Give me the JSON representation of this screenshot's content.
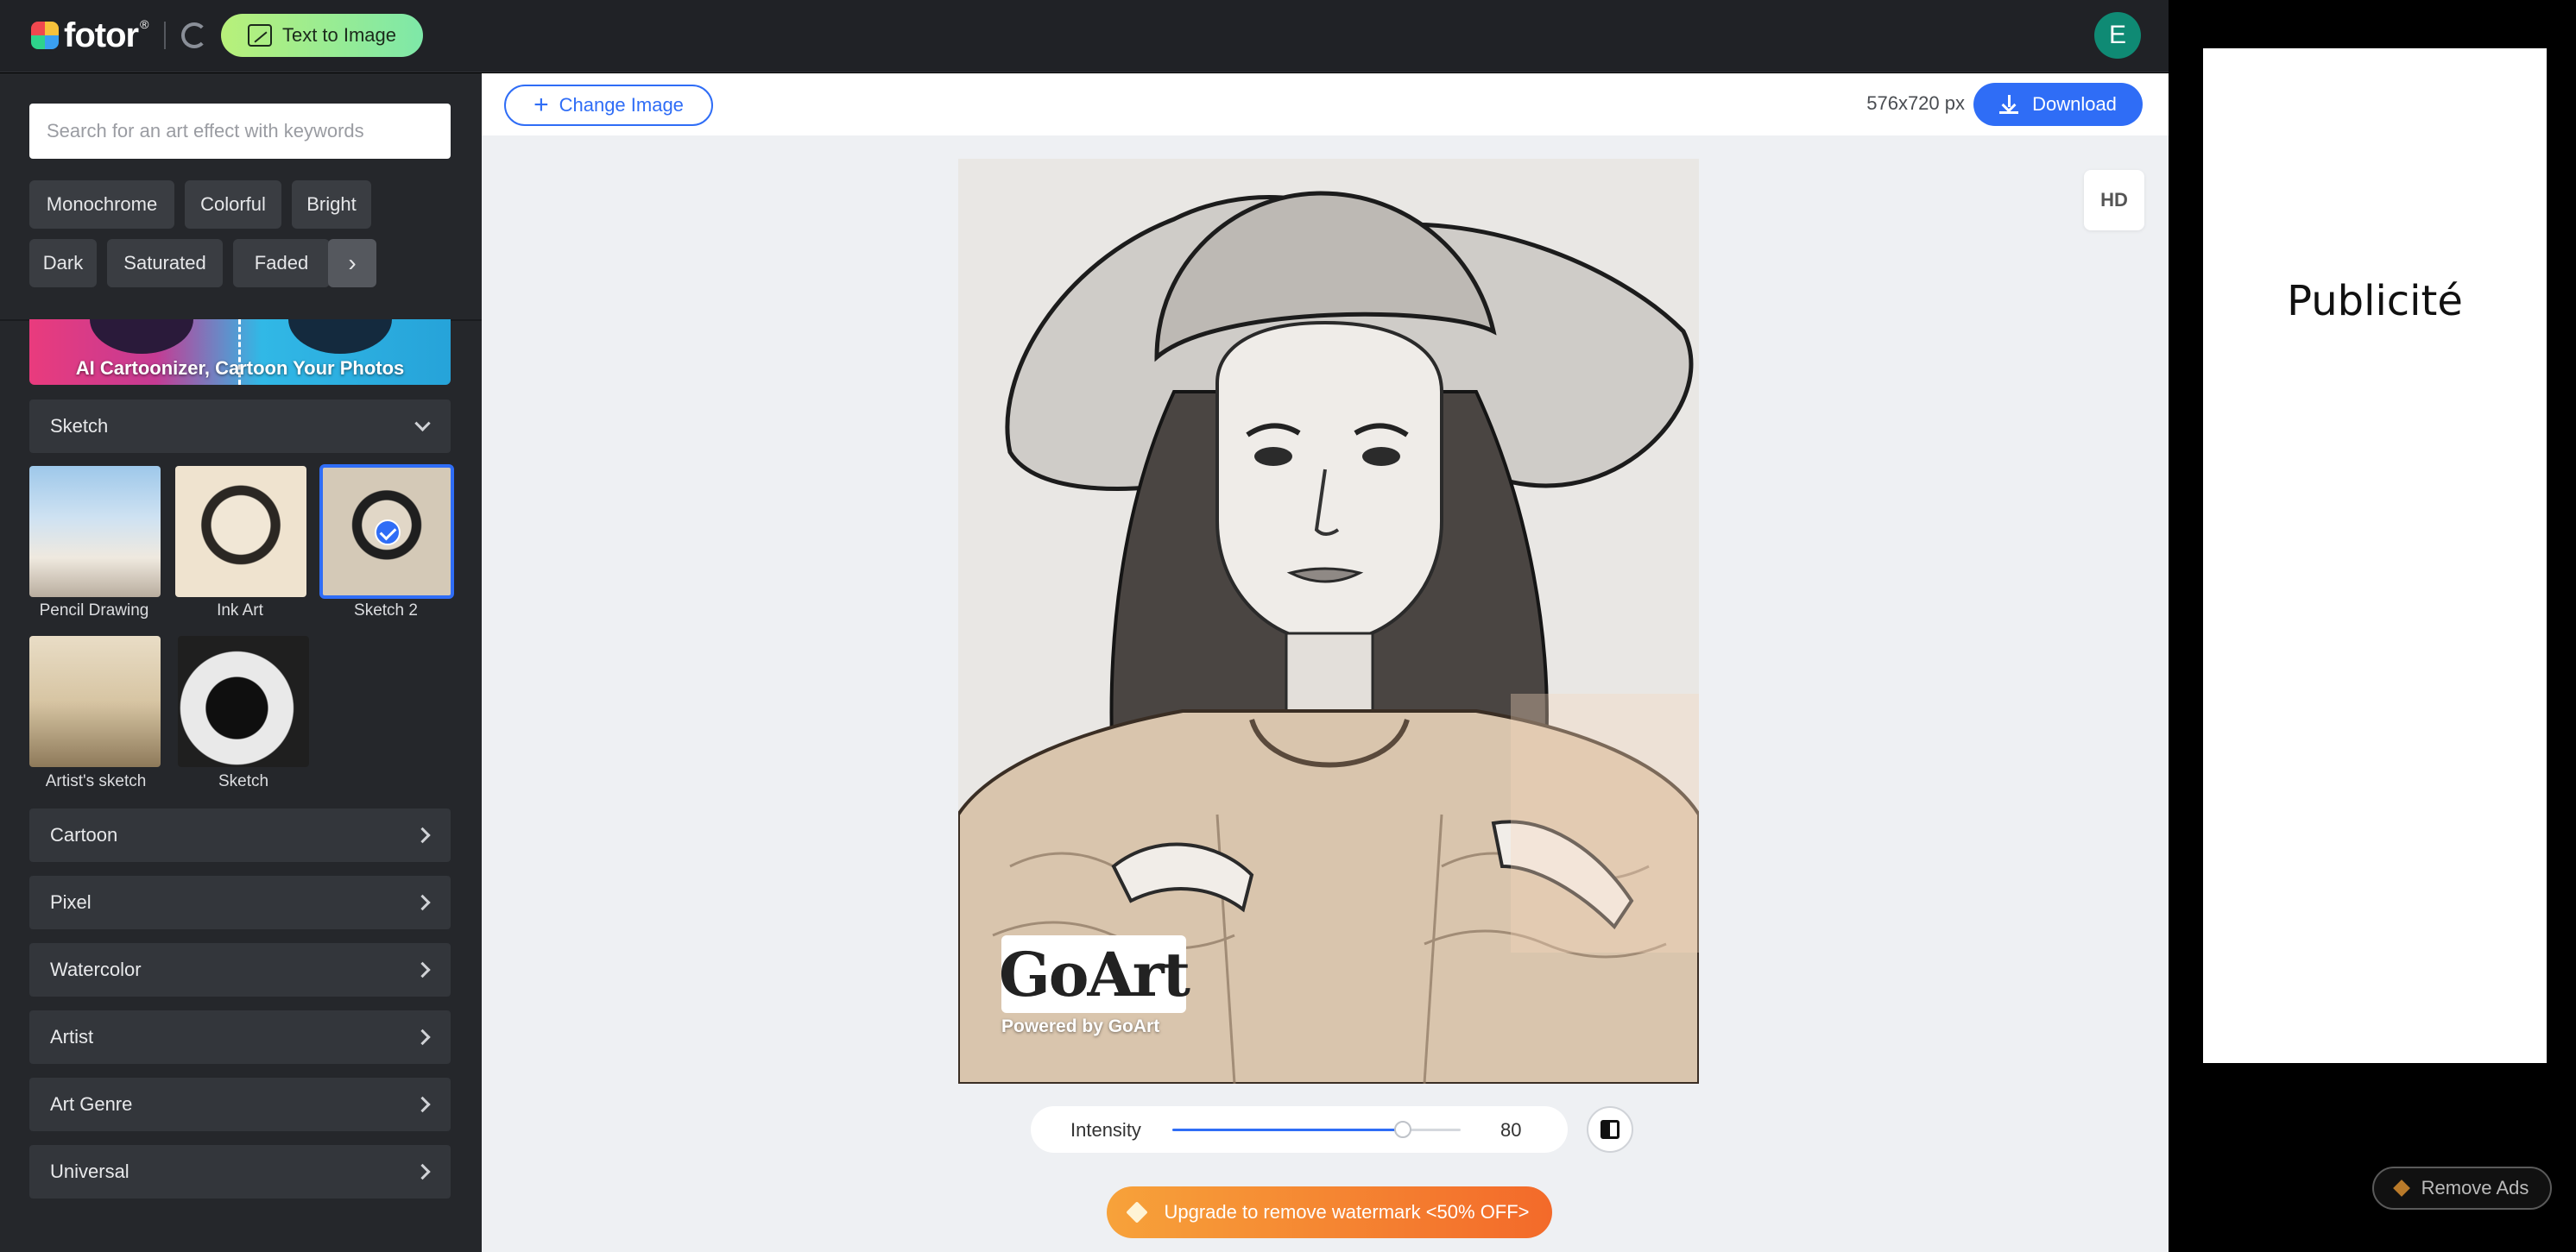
{
  "header": {
    "logo_text": "fotor",
    "logo_reg": "®",
    "text_to_image_label": "Text to Image",
    "avatar_initial": "E"
  },
  "sidebar": {
    "search_placeholder": "Search for an art effect with keywords",
    "filter_chips": [
      "Monochrome",
      "Colorful",
      "Bright",
      "Dark",
      "Saturated",
      "Faded"
    ],
    "banner_text": "AI Cartoonizer, Cartoon Your Photos",
    "open_category": "Sketch",
    "effects": [
      {
        "label": "Pencil Drawing",
        "selected": false
      },
      {
        "label": "Ink Art",
        "selected": false
      },
      {
        "label": "Sketch 2",
        "selected": true
      },
      {
        "label": "Artist's sketch",
        "selected": false
      },
      {
        "label": "Sketch",
        "selected": false
      }
    ],
    "categories": [
      "Cartoon",
      "Pixel",
      "Watercolor",
      "Artist",
      "Art Genre",
      "Universal"
    ]
  },
  "toolbar": {
    "change_image_label": "Change Image",
    "dimensions": "576x720 px",
    "download_label": "Download",
    "hd_label": "HD"
  },
  "canvas": {
    "watermark_logo": "GoArt",
    "watermark_caption": "Powered by GoArt"
  },
  "intensity": {
    "label": "Intensity",
    "value": "80",
    "fraction": 0.8
  },
  "upgrade_label": "Upgrade to remove watermark <50% OFF>",
  "ad": {
    "label": "Publicité",
    "remove_ads_label": "Remove Ads"
  },
  "colors": {
    "accent": "#2f6df6",
    "topbar": "#202226",
    "sidebar": "#25272b",
    "upgrade_start": "#f7a23a",
    "upgrade_end": "#f36a2a"
  }
}
